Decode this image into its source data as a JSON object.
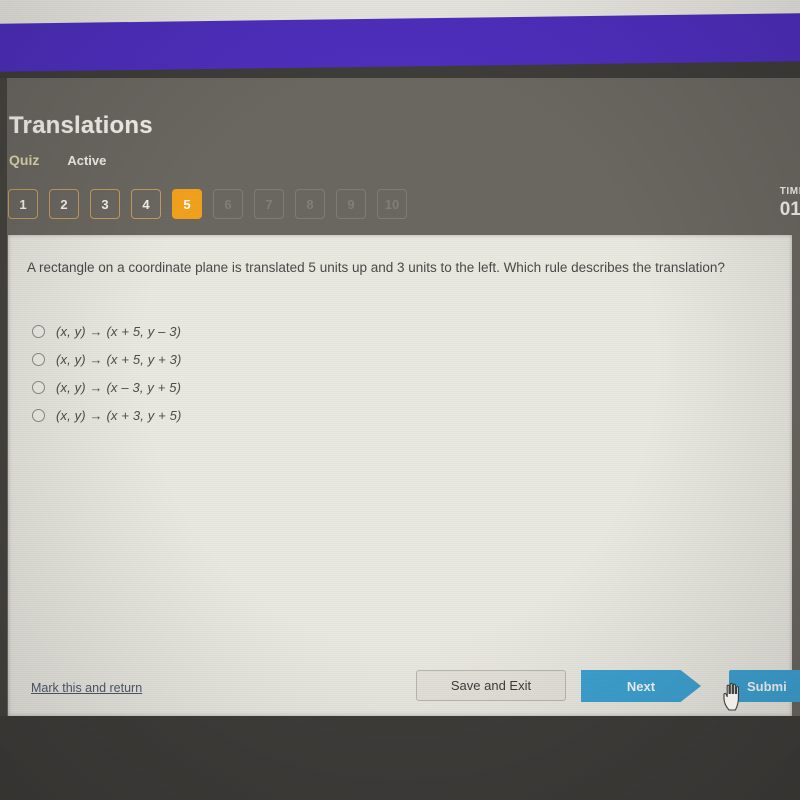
{
  "header": {
    "title": "Translations",
    "status_type": "Quiz",
    "status_state": "Active",
    "timer_label": "TIME",
    "timer_value": "01"
  },
  "question_nav": {
    "items": [
      {
        "number": "1",
        "state": "answered"
      },
      {
        "number": "2",
        "state": "answered"
      },
      {
        "number": "3",
        "state": "answered"
      },
      {
        "number": "4",
        "state": "answered"
      },
      {
        "number": "5",
        "state": "current"
      },
      {
        "number": "6",
        "state": "locked"
      },
      {
        "number": "7",
        "state": "locked"
      },
      {
        "number": "8",
        "state": "locked"
      },
      {
        "number": "9",
        "state": "locked"
      },
      {
        "number": "10",
        "state": "locked"
      }
    ]
  },
  "question": {
    "text": "A rectangle on a coordinate plane is translated 5 units up and 3 units to the left. Which rule describes the translation?",
    "options": [
      {
        "label": "(x, y) → (x + 5, y – 3)",
        "selected": false
      },
      {
        "label": "(x, y) → (x + 5, y + 3)",
        "selected": false
      },
      {
        "label": "(x, y) → (x – 3, y + 5)",
        "selected": false
      },
      {
        "label": "(x, y) → (x + 3, y + 5)",
        "selected": false
      }
    ]
  },
  "footer": {
    "mark_return_label": "Mark this and return",
    "save_exit_label": "Save and Exit",
    "next_label": "Next",
    "submit_label": "Submi"
  },
  "colors": {
    "accent_purple": "#4e2fbe",
    "current_question_orange": "#f2a11c",
    "button_blue": "#3ea2d2",
    "card_background": "#e9e8e1",
    "chrome_gray": "#6b6862",
    "quiz_label_gold": "#ded6a8"
  }
}
